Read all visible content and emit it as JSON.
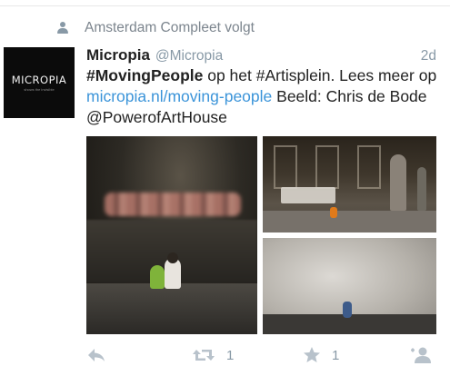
{
  "context": {
    "icon": "person-icon",
    "label": "Amsterdam Compleet volgt"
  },
  "tweet": {
    "avatar": {
      "logo_text": "MICROPIA",
      "tagline": "shows the invisible"
    },
    "name": "Micropia",
    "handle": "@Micropia",
    "time": "2d",
    "text": {
      "hashtag1": "#MovingPeople",
      "part1": " op het #Artisplein. Lees meer op ",
      "link": "micropia.nl/moving-people",
      "part2": " Beeld: Chris de Bode @PowerofArtHouse"
    },
    "media": [
      {
        "icon": "photo-icon"
      },
      {
        "icon": "photo-icon"
      },
      {
        "icon": "photo-icon"
      }
    ],
    "actions": {
      "reply": {
        "icon": "reply-icon"
      },
      "retweet": {
        "icon": "retweet-icon",
        "count": "1"
      },
      "favorite": {
        "icon": "star-icon",
        "count": "1"
      },
      "follow": {
        "icon": "add-user-icon"
      }
    }
  },
  "colors": {
    "accent_link": "#3b94d9",
    "muted": "#8899a6",
    "icon_gray": "#b8c2cb"
  }
}
